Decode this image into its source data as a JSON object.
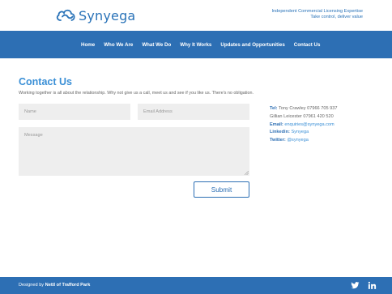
{
  "header": {
    "logo_text": "Synyega",
    "tagline_line1": "Independent Commercial Licensing Expertise",
    "tagline_line2": "Take control, deliver value"
  },
  "nav": {
    "items": [
      {
        "label": "Home"
      },
      {
        "label": "Who We Are"
      },
      {
        "label": "What We Do"
      },
      {
        "label": "Why It Works"
      },
      {
        "label": "Updates and Opportunities"
      },
      {
        "label": "Contact Us"
      }
    ]
  },
  "main": {
    "title": "Contact Us",
    "intro": "Working together is all about the relationship. Why not give us a call, meet us and see if you like us. There's no obligation.",
    "form": {
      "name_placeholder": "Name",
      "name_value": "",
      "email_placeholder": "Email Address",
      "email_value": "",
      "message_placeholder": "Message",
      "message_value": "",
      "submit_label": "Submit"
    },
    "contact": {
      "tel_label": "Tel:",
      "tel_line1": "Tony Crawley 07966 705 937",
      "tel_line2": "Gillian Leicester 07961 420 520",
      "email_label": "Email:",
      "email_value": "enquiries@synyega.com",
      "linkedin_label": "Linkedin:",
      "linkedin_value": "Synyega",
      "twitter_label": "Twitter:",
      "twitter_value": "@synyega"
    }
  },
  "footer": {
    "credit_prefix": "Designed by",
    "credit_name": "Nettl of Trafford Park",
    "icons": [
      "twitter-icon",
      "linkedin-icon"
    ]
  },
  "colors": {
    "brand_blue": "#2d6fb4",
    "title_blue": "#3a8fd6",
    "field_bg": "#eeeeee"
  }
}
